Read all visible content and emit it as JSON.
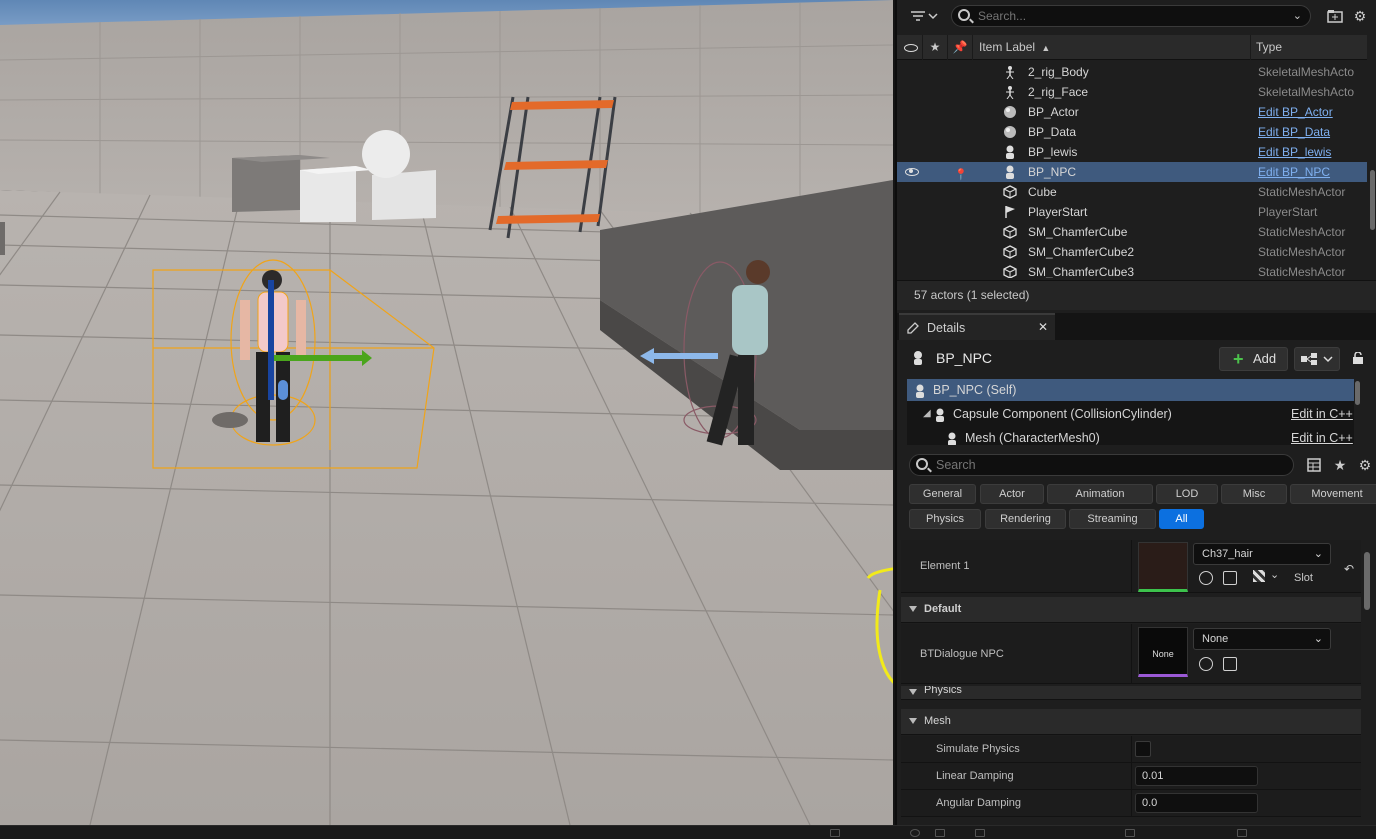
{
  "outliner": {
    "search_placeholder": "Search...",
    "columns": {
      "item_label": "Item Label",
      "type": "Type"
    },
    "rows": [
      {
        "label": "2_rig_Body",
        "type": "SkeletalMeshActo",
        "link": false,
        "icon": "skeleton-icon",
        "selected": false
      },
      {
        "label": "2_rig_Face",
        "type": "SkeletalMeshActo",
        "link": false,
        "icon": "skeleton-icon",
        "selected": false
      },
      {
        "label": "BP_Actor",
        "type": "Edit BP_Actor",
        "link": true,
        "icon": "actor-sphere-icon",
        "selected": false
      },
      {
        "label": "BP_Data",
        "type": "Edit BP_Data",
        "link": true,
        "icon": "actor-sphere-icon",
        "selected": false
      },
      {
        "label": "BP_lewis",
        "type": "Edit BP_lewis",
        "link": true,
        "icon": "pawn-icon",
        "selected": false
      },
      {
        "label": "BP_NPC",
        "type": "Edit BP_NPC",
        "link": true,
        "icon": "pawn-icon",
        "selected": true
      },
      {
        "label": "Cube",
        "type": "StaticMeshActor",
        "link": false,
        "icon": "static-mesh-icon",
        "selected": false
      },
      {
        "label": "PlayerStart",
        "type": "PlayerStart",
        "link": false,
        "icon": "player-start-icon",
        "selected": false
      },
      {
        "label": "SM_ChamferCube",
        "type": "StaticMeshActor",
        "link": false,
        "icon": "static-mesh-icon",
        "selected": false
      },
      {
        "label": "SM_ChamferCube2",
        "type": "StaticMeshActor",
        "link": false,
        "icon": "static-mesh-icon",
        "selected": false
      },
      {
        "label": "SM_ChamferCube3",
        "type": "StaticMeshActor",
        "link": false,
        "icon": "static-mesh-icon",
        "selected": false
      }
    ],
    "footer": "57 actors (1 selected)"
  },
  "details": {
    "tab_label": "Details",
    "actor_name": "BP_NPC",
    "add_label": "Add",
    "components": [
      {
        "label": "BP_NPC (Self)",
        "edit": "",
        "indent": 1,
        "selected": true
      },
      {
        "label": "Capsule Component (CollisionCylinder)",
        "edit": "Edit in C++",
        "indent": 2,
        "selected": false
      },
      {
        "label": "Mesh (CharacterMesh0)",
        "edit": "Edit in C++",
        "indent": 3,
        "selected": false
      }
    ],
    "search_placeholder": "Search",
    "categories_row1": [
      "General",
      "Actor",
      "Animation",
      "LOD",
      "Misc",
      "Movement"
    ],
    "categories_row2": [
      "Physics",
      "Rendering",
      "Streaming",
      "All"
    ],
    "active_category": "All",
    "element1": {
      "label": "Element 1",
      "material": "Ch37_hair",
      "slot_label": "Slot"
    },
    "default_section": {
      "title": "Default",
      "property": "BTDialogue NPC",
      "thumb_text": "None",
      "value": "None"
    },
    "physics_section_partial": "Physics",
    "mesh_section": {
      "title": "Mesh",
      "simulate_physics_label": "Simulate Physics",
      "simulate_physics": false,
      "linear_damping_label": "Linear Damping",
      "linear_damping": "0.01",
      "angular_damping_label": "Angular Damping",
      "angular_damping": "0.0"
    }
  },
  "colors": {
    "selection": "#3f5a7e",
    "link": "#7fb0f0",
    "active_category": "#0c70e0",
    "add_plus": "#4cc24c",
    "annotation_circle": "#f2ea1a",
    "selection_outline": "#f0a419"
  }
}
